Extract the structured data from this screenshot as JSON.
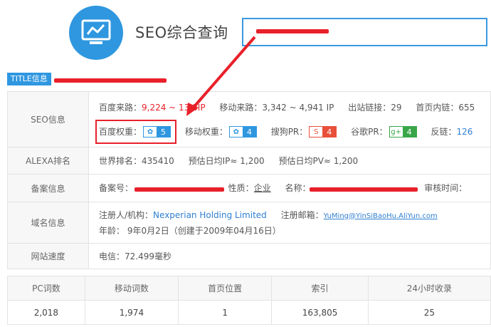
{
  "header": {
    "title": "SEO综合查询"
  },
  "title_badge": "TITLE信息",
  "seo": {
    "label": "SEO信息",
    "baidu_traffic_label": "百度来路：",
    "baidu_traffic_value": "9,224 ~ 13,8",
    "baidu_traffic_unit": "IP",
    "mobile_traffic_label": "移动来路：",
    "mobile_traffic_value": "3,342 ~ 4,941 IP",
    "outlinks_label": "出站链接：",
    "outlinks_value": "29",
    "inlinks_label": "首页内链：",
    "inlinks_value": "655",
    "baidu_weight_label": "百度权重：",
    "baidu_weight_value": "5",
    "mobile_weight_label": "移动权重：",
    "mobile_weight_value": "4",
    "sogou_label": "搜狗PR：",
    "sogou_value": "4",
    "google_label": "谷歌PR：",
    "google_value": "4",
    "backlinks_label": "反链：",
    "backlinks_value": "126"
  },
  "alexa": {
    "label": "ALEXA排名",
    "world_rank": "世界排名：435410",
    "est_ip": "预估日均IP≈ 1,200",
    "est_pv": "预估日均PV≈ 1,200"
  },
  "icp": {
    "label": "备案信息",
    "number_label": "备案号：",
    "nature_label": "性质：",
    "nature_value": "企业",
    "name_label": "名称：",
    "review_label": "审核时间："
  },
  "domain": {
    "label": "域名信息",
    "registrant_label": "注册人/机构：",
    "registrant_value": "Nexperian Holding Limited",
    "email_label": "注册邮箱：",
    "email_value": "YuMing@YinSiBaoHu.AliYun.com",
    "age_text": "年龄： 9年0月2日（创建于2009年04月16日）"
  },
  "speed": {
    "label": "网站速度",
    "value": "电信：72.499毫秒"
  },
  "stats": {
    "headers": [
      "PC词数",
      "移动词数",
      "首页位置",
      "索引",
      "24小时收录"
    ],
    "values": [
      "2,018",
      "1,974",
      "1",
      "163,805",
      "25"
    ]
  },
  "colors": {
    "accent": "#2f97e0",
    "highlight": "#e8202a",
    "sogou": "#e8503a",
    "google": "#3aa64a"
  },
  "icons": {
    "logo": "monitor-chart-icon",
    "baidu": "baidu-paw-icon",
    "sogou": "sogou-s-icon",
    "google": "google-plus-icon"
  }
}
